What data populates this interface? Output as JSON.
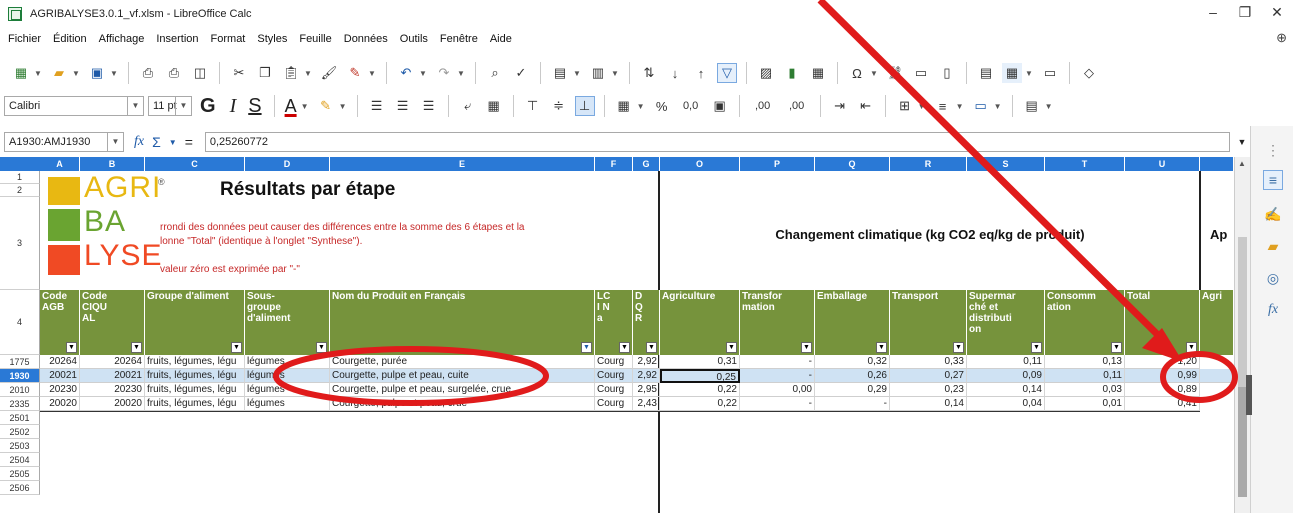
{
  "window": {
    "title": "AGRIBALYSE3.0.1_vf.xlsm - LibreOffice Calc",
    "controls": [
      "–",
      "❐",
      "✕"
    ]
  },
  "menu": [
    "Fichier",
    "Édition",
    "Affichage",
    "Insertion",
    "Format",
    "Styles",
    "Feuille",
    "Données",
    "Outils",
    "Fenêtre",
    "Aide"
  ],
  "format": {
    "font_name": "Calibri",
    "font_size": "11 pt",
    "bold": "G",
    "italic": "I",
    "underline": "S",
    "font_color": "A",
    "percent": "%",
    "number_format": "0,0",
    "add_decimal": ",00",
    "delete_decimal": ",00"
  },
  "formula_bar": {
    "name_box": "A1930:AMJ1930",
    "fx": "fx",
    "sum": "Σ",
    "equals": "=",
    "content": "0,25260772"
  },
  "columns": [
    "A",
    "B",
    "C",
    "D",
    "E",
    "F",
    "G",
    "O",
    "P",
    "Q",
    "R",
    "S",
    "T",
    "U"
  ],
  "rows": [
    "1",
    "2",
    "3",
    "4",
    "1775",
    "1930",
    "2010",
    "2335",
    "2501",
    "2502",
    "2503",
    "2504",
    "2505",
    "2506"
  ],
  "logo": {
    "line1": "AGRI",
    "line2": "BA",
    "line3": "LYSE",
    "mark": "®"
  },
  "sheet": {
    "title": "Résultats par étape",
    "note1": "rrondi des données peut causer des différences entre la somme des 6 étapes et la",
    "note2": "lonne \"Total\" (identique à l'onglet \"Synthese\").",
    "note3": "valeur zéro est exprimée par \"-\"",
    "section_title": "Changement climatique (kg CO2 eq/kg de produit)",
    "next_section": "Ap"
  },
  "headers": {
    "A": "Code AGB",
    "B": "Code CIQU AL",
    "C": "Groupe d'aliment",
    "D": "Sous-groupe d'aliment",
    "E": "Nom du Produit en Français",
    "F": "LC I N a",
    "G": "D Q R",
    "O": "Agriculture",
    "P": "Transfor mation",
    "Q": "Emballage",
    "R": "Transport",
    "S": "Supermar ché et distributi on",
    "T": "Consomm ation",
    "U": "Total",
    "V": "Agri"
  },
  "data_rows": [
    {
      "row": "1775",
      "A": "20264",
      "B": "20264",
      "C": "fruits, légumes, légu",
      "D": "légumes",
      "E": "Courgette, purée",
      "F": "Courg",
      "G": "2,92",
      "O": "0,31",
      "P": "-",
      "Q": "0,32",
      "R": "0,33",
      "S": "0,11",
      "T": "0,13",
      "U": "1,20"
    },
    {
      "row": "1930",
      "A": "20021",
      "B": "20021",
      "C": "fruits, légumes, légu",
      "D": "légumes",
      "E": "Courgette, pulpe et peau, cuite",
      "F": "Courg",
      "G": "2,92",
      "O": "0,25",
      "P": "-",
      "Q": "0,26",
      "R": "0,27",
      "S": "0,09",
      "T": "0,11",
      "U": "0,99"
    },
    {
      "row": "2010",
      "A": "20230",
      "B": "20230",
      "C": "fruits, légumes, légu",
      "D": "légumes",
      "E": "Courgette, pulpe et peau, surgelée, crue",
      "F": "Courg",
      "G": "2,95",
      "O": "0,22",
      "P": "0,00",
      "Q": "0,29",
      "R": "0,23",
      "S": "0,14",
      "T": "0,03",
      "U": "0,89"
    },
    {
      "row": "2335",
      "A": "20020",
      "B": "20020",
      "C": "fruits, légumes, légu",
      "D": "légumes",
      "E": "Courgette, pulpe et peau, crue",
      "F": "Courg",
      "G": "2,43",
      "O": "0,22",
      "P": "-",
      "Q": "-",
      "R": "0,14",
      "S": "0,04",
      "T": "0,01",
      "U": "0,41"
    }
  ],
  "colors": {
    "column_header": "#2a79d6",
    "table_header": "#76933c",
    "selected_row": "#cfe2f3",
    "annotation": "#e01b1b"
  }
}
